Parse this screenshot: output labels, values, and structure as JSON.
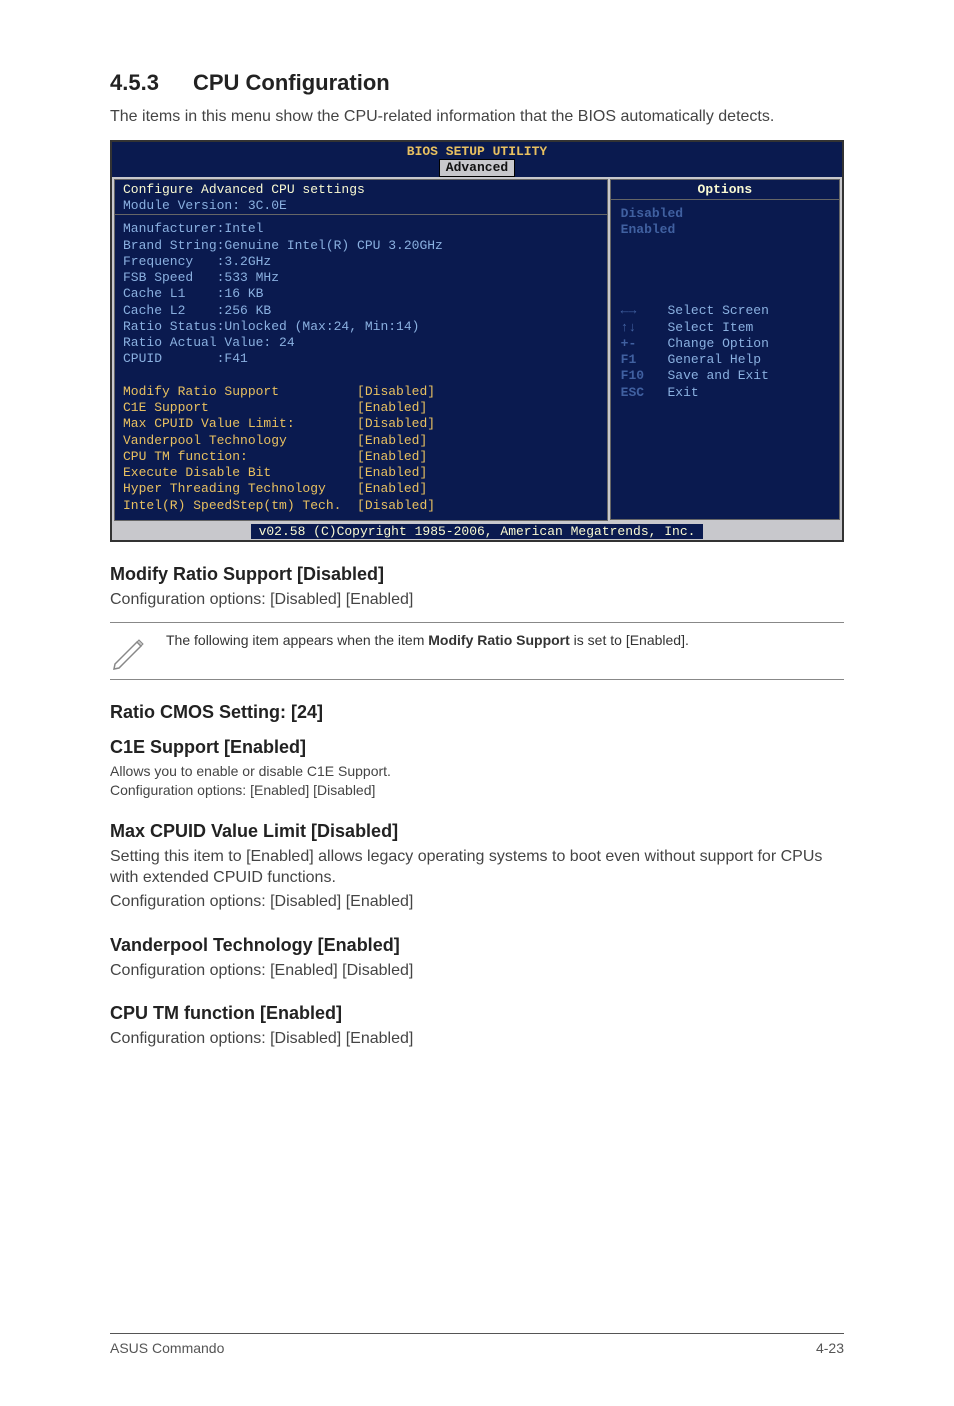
{
  "section": {
    "number": "4.5.3",
    "title": "CPU Configuration"
  },
  "intro": "The items in this menu show the CPU-related information that the BIOS automatically detects.",
  "bios": {
    "title": "BIOS SETUP UTILITY",
    "tab": "Advanced",
    "header_line1": "Configure Advanced CPU settings",
    "header_line2": "Module Version: 3C.0E",
    "static_lines": "Manufacturer:Intel\nBrand String:Genuine Intel(R) CPU 3.20GHz\nFrequency   :3.2GHz\nFSB Speed   :533 MHz\nCache L1    :16 KB\nCache L2    :256 KB\nRatio Status:Unlocked (Max:24, Min:14)\nRatio Actual Value: 24\nCPUID       :F41",
    "editable": [
      {
        "label": "Modify Ratio Support",
        "value": "[Disabled]"
      },
      {
        "label": "C1E Support",
        "value": "[Enabled]"
      },
      {
        "label": "Max CPUID Value Limit:",
        "value": "[Disabled]"
      },
      {
        "label": "Vanderpool Technology",
        "value": "[Enabled]"
      },
      {
        "label": "CPU TM function:",
        "value": "[Enabled]"
      },
      {
        "label": "Execute Disable Bit",
        "value": "[Enabled]"
      },
      {
        "label": "Hyper Threading Technology",
        "value": "[Enabled]"
      },
      {
        "label": "Intel(R) SpeedStep(tm) Tech.",
        "value": "[Disabled]"
      }
    ],
    "options_title": "Options",
    "options_values": "Disabled\nEnabled",
    "nav_help": [
      {
        "key": "←→",
        "text": "Select Screen"
      },
      {
        "key": "↑↓",
        "text": "Select Item"
      },
      {
        "key": "+-",
        "text": "Change Option"
      },
      {
        "key": "F1",
        "text": "General Help"
      },
      {
        "key": "F10",
        "text": "Save and Exit"
      },
      {
        "key": "ESC",
        "text": "Exit"
      }
    ],
    "footer": "v02.58 (C)Copyright 1985-2006, American Megatrends, Inc."
  },
  "sections": {
    "modify_ratio": {
      "heading": "Modify Ratio Support [Disabled]",
      "text": "Configuration options: [Disabled] [Enabled]"
    },
    "note": {
      "prefix": "The following item appears when the item ",
      "bold": "Modify Ratio Support",
      "suffix": " is set to [Enabled]."
    },
    "ratio_cmos": {
      "heading": "Ratio CMOS Setting: [24]"
    },
    "c1e": {
      "heading": "C1E Support [Enabled]",
      "line1": "Allows you to enable or disable C1E Support.",
      "line2": "Configuration options: [Enabled] [Disabled]"
    },
    "max_cpuid": {
      "heading": "Max CPUID Value Limit [Disabled]",
      "line1": "Setting this item to [Enabled] allows legacy operating systems to boot even without support for CPUs with extended CPUID functions.",
      "line2": "Configuration options: [Disabled] [Enabled]"
    },
    "vanderpool": {
      "heading": "Vanderpool Technology [Enabled]",
      "line1": "Configuration options: [Enabled] [Disabled]"
    },
    "cputm": {
      "heading": "CPU TM function [Enabled]",
      "line1": "Configuration options: [Disabled] [Enabled]"
    }
  },
  "pagefoot": {
    "left": "ASUS Commando",
    "right": "4-23"
  }
}
